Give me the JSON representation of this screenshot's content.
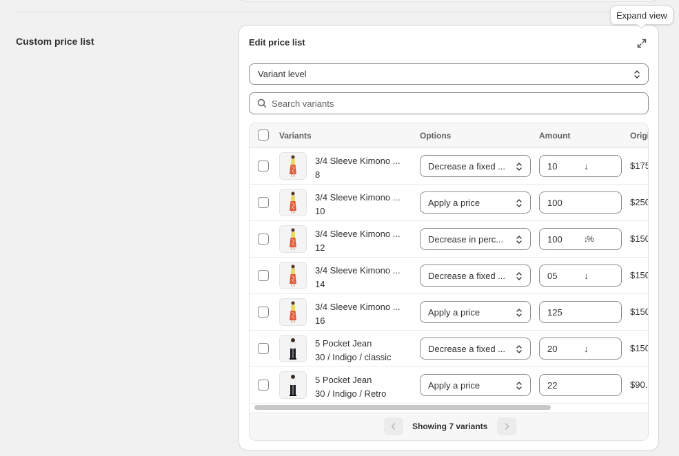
{
  "section": {
    "title": "Custom price list"
  },
  "card": {
    "title": "Edit price list",
    "expand_tooltip": "Expand view",
    "level_select": "Variant level",
    "search_placeholder": "Search variants"
  },
  "table": {
    "headers": {
      "variants": "Variants",
      "options": "Options",
      "amount": "Amount",
      "original": "Origi"
    },
    "rows": [
      {
        "name": "3/4 Sleeve Kimono ...",
        "variant": "8",
        "option": "Decrease a fixed ...",
        "amount": "10",
        "arrow": "↓",
        "original": "$175",
        "thumb": "dress"
      },
      {
        "name": "3/4 Sleeve Kimono ...",
        "variant": "10",
        "option": "Apply a price",
        "amount": "100",
        "arrow": "",
        "original": "$250",
        "thumb": "dress"
      },
      {
        "name": "3/4 Sleeve Kimono ...",
        "variant": "12",
        "option": "Decrease in perc...",
        "amount": "100",
        "arrow": "↓%",
        "original": "$150",
        "thumb": "dress"
      },
      {
        "name": "3/4 Sleeve Kimono ...",
        "variant": "14",
        "option": "Decrease a fixed ...",
        "amount": "05",
        "arrow": "↓",
        "original": "$150",
        "thumb": "dress"
      },
      {
        "name": "3/4 Sleeve Kimono ...",
        "variant": "16",
        "option": "Apply a price",
        "amount": "125",
        "arrow": "",
        "original": "$150",
        "thumb": "dress"
      },
      {
        "name": "5 Pocket Jean",
        "variant": "30 / Indigo / classic",
        "option": "Decrease a fixed ...",
        "amount": "20",
        "arrow": "↓",
        "original": "$150",
        "thumb": "jean"
      },
      {
        "name": "5 Pocket Jean",
        "variant": "30 / Indigo / Retro",
        "option": "Apply a price",
        "amount": "22",
        "arrow": "",
        "original": "$90.",
        "thumb": "jean"
      }
    ]
  },
  "pagination": {
    "text": "Showing 7 variants",
    "prev_icon": "chevron-left-icon",
    "next_icon": "chevron-right-icon"
  },
  "colors": {
    "background": "#f1f1f1",
    "card": "#ffffff",
    "border": "#8a8a8a",
    "text": "#303030",
    "muted": "#616161"
  }
}
